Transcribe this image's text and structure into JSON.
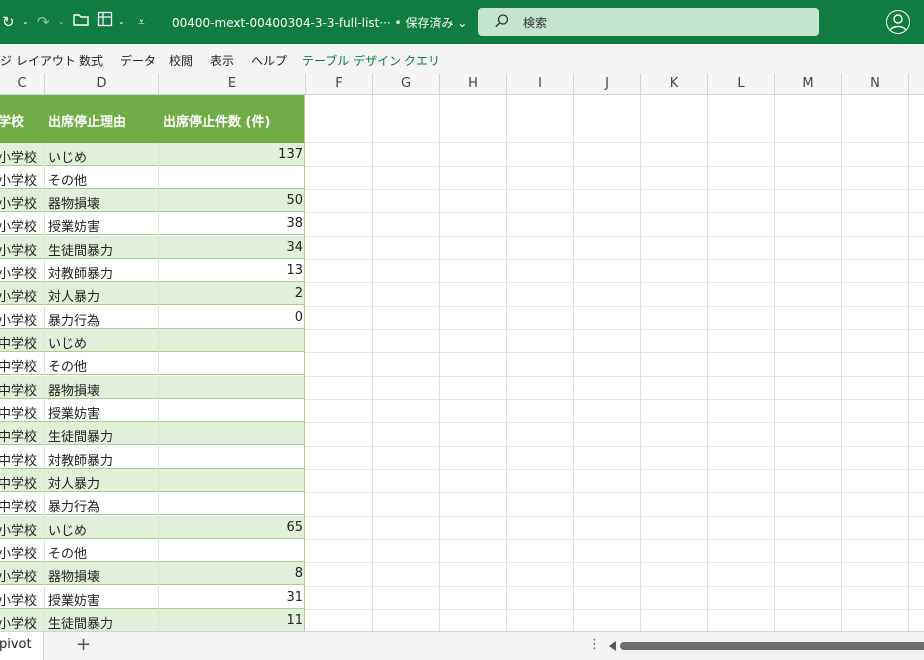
{
  "titlebar": {
    "doc_title": "00400-mext-00400304-3-3-full-list···  •  保存済み ⌄",
    "search_label": "検索",
    "icons": [
      "redo-icon",
      "open-folder-icon",
      "form-icon",
      "customize-toolbar-icon",
      "search-icon",
      "account-icon"
    ]
  },
  "ribbon": {
    "tabs": [
      "ジ レイアウト",
      "数式",
      "データ",
      "校閲",
      "表示",
      "ヘルプ",
      "テーブル デザイン",
      "クエリ"
    ]
  },
  "columns": [
    "C",
    "D",
    "E",
    "F",
    "G",
    "H",
    "I",
    "J",
    "K",
    "L",
    "M",
    "N"
  ],
  "table": {
    "headers": {
      "school": "学校",
      "reason": "出席停止理由",
      "count": "出席停止件数 (件)"
    },
    "rows": [
      {
        "school": "小学校",
        "reason": "いじめ",
        "count": "137"
      },
      {
        "school": "小学校",
        "reason": "その他",
        "count": ""
      },
      {
        "school": "小学校",
        "reason": "器物損壊",
        "count": "50"
      },
      {
        "school": "小学校",
        "reason": "授業妨害",
        "count": "38"
      },
      {
        "school": "小学校",
        "reason": "生徒間暴力",
        "count": "34"
      },
      {
        "school": "小学校",
        "reason": "対教師暴力",
        "count": "13"
      },
      {
        "school": "小学校",
        "reason": "対人暴力",
        "count": "2"
      },
      {
        "school": "小学校",
        "reason": "暴力行為",
        "count": "0"
      },
      {
        "school": "中学校",
        "reason": "いじめ",
        "count": ""
      },
      {
        "school": "中学校",
        "reason": "その他",
        "count": ""
      },
      {
        "school": "中学校",
        "reason": "器物損壊",
        "count": ""
      },
      {
        "school": "中学校",
        "reason": "授業妨害",
        "count": ""
      },
      {
        "school": "中学校",
        "reason": "生徒間暴力",
        "count": ""
      },
      {
        "school": "中学校",
        "reason": "対教師暴力",
        "count": ""
      },
      {
        "school": "中学校",
        "reason": "対人暴力",
        "count": ""
      },
      {
        "school": "中学校",
        "reason": "暴力行為",
        "count": ""
      },
      {
        "school": "小学校",
        "reason": "いじめ",
        "count": "65"
      },
      {
        "school": "小学校",
        "reason": "その他",
        "count": ""
      },
      {
        "school": "小学校",
        "reason": "器物損壊",
        "count": "8"
      },
      {
        "school": "小学校",
        "reason": "授業妨害",
        "count": "31"
      },
      {
        "school": "小学校",
        "reason": "生徒間暴力",
        "count": "11"
      }
    ]
  },
  "sheet_tab": "pivot",
  "add_sheet": "+",
  "colors": {
    "titlebar": "#107c41",
    "table_header": "#70ad47",
    "band": "#e2efda",
    "context_tab": "#107c41"
  }
}
